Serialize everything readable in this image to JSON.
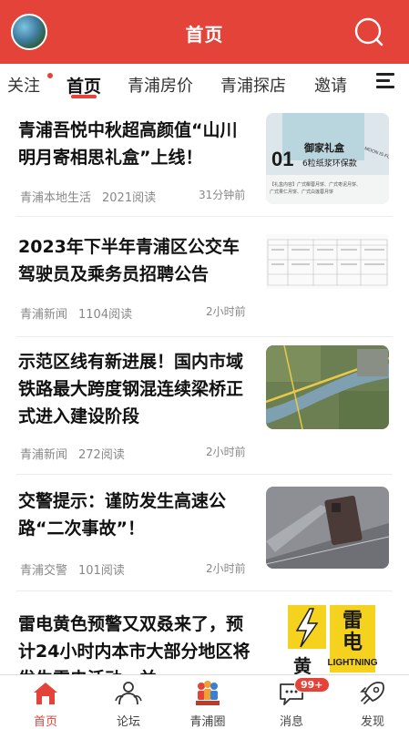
{
  "header": {
    "title": "首页",
    "avatar_icon": "user-avatar",
    "search_icon": "search-icon"
  },
  "tabs": [
    {
      "label": "关注",
      "has_dot": true
    },
    {
      "label": "首页",
      "active": true
    },
    {
      "label": "青浦房价"
    },
    {
      "label": "青浦探店"
    },
    {
      "label": "邀请"
    }
  ],
  "articles": [
    {
      "title": "青浦吾悦中秋超高颜值“山川明月寄相思礼盒”上线！",
      "source": "青浦本地生活",
      "views": "2021阅读",
      "time": "31分钟前",
      "thumb": {
        "line1": "御家礼盒",
        "num": "01",
        "line2": "6粒纸浆环保款",
        "side": "MOON IS FULL",
        "note1": "【礼盒内容】广式椰蓉月饼、广式枣泥月饼、",
        "note2": "广式果仁月饼、广式白莲蓉月饼"
      }
    },
    {
      "title": "2023年下半年青浦区公交车驾驶员及乘务员招聘公告",
      "source": "青浦新闻",
      "views": "1104阅读",
      "time": "2小时前"
    },
    {
      "title": "示范区线有新进展！国内市域铁路最大跨度钢混连续梁桥正式进入建设阶段",
      "source": "青浦新闻",
      "views": "272阅读",
      "time": "2小时前"
    },
    {
      "title": "交警提示：谨防发生高速公路“二次事故”！",
      "source": "青浦交警",
      "views": "101阅读",
      "time": "2小时前"
    },
    {
      "title": "雷电黄色预警又双叒来了，预计24小时内本市大部分地区将发生雷电活动，并…",
      "thumb": {
        "char1": "雷",
        "char2": "电",
        "char3": "黄",
        "en": "LIGHTNING"
      }
    }
  ],
  "bottom_nav": [
    {
      "label": "首页",
      "icon": "home-icon",
      "active": true
    },
    {
      "label": "论坛",
      "icon": "forum-icon"
    },
    {
      "label": "青浦圈",
      "icon": "community-icon"
    },
    {
      "label": "消息",
      "icon": "message-icon",
      "badge": "99+"
    },
    {
      "label": "发现",
      "icon": "rocket-icon"
    }
  ],
  "colors": {
    "brand": "#e4433a",
    "text": "#111111",
    "meta": "#888888"
  }
}
